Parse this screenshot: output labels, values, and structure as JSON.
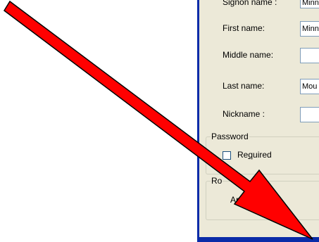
{
  "form": {
    "signon_label": "Signon name :",
    "signon_value": "Minn",
    "first_label": "First name:",
    "first_value": "Minn",
    "middle_label": "Middle name:",
    "middle_value": "",
    "last_label": "Last name:",
    "last_value": "Mou",
    "nickname_label": "Nickname :",
    "nickname_value": ""
  },
  "password": {
    "legend": "Password",
    "required_label_pre": "Re",
    "required_label_u": "q",
    "required_label_post": "uired",
    "required_checked": false
  },
  "role": {
    "legend": "Ro",
    "archive_label": "Arch"
  },
  "annotation": {
    "arrow_color": "#ff0000"
  }
}
